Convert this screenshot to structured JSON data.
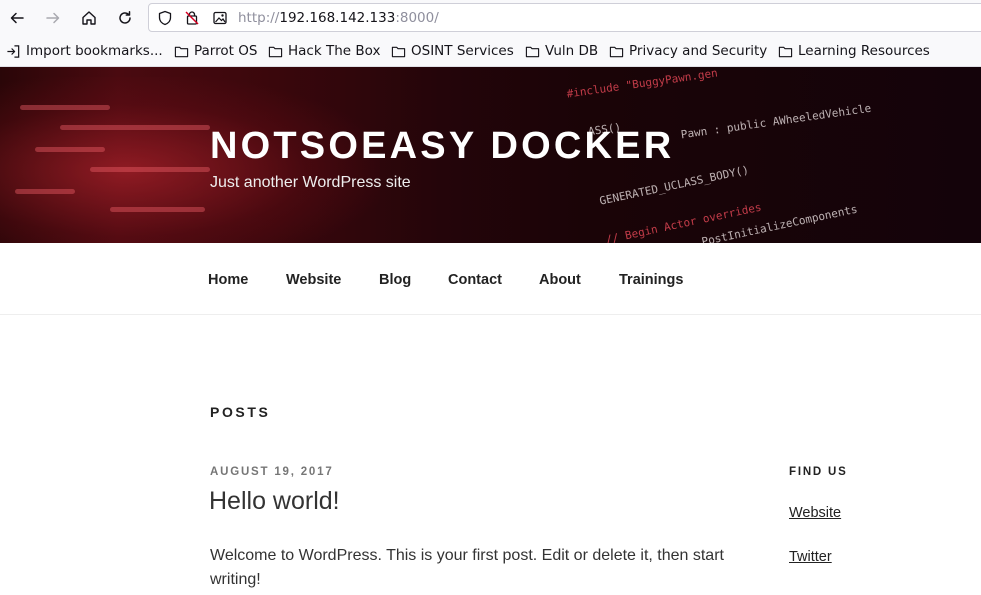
{
  "browser": {
    "url_protocol": "http://",
    "url_host": "192.168.142.133",
    "url_port": ":8000/",
    "icons": [
      "back-icon",
      "forward-icon",
      "home-icon",
      "reload-icon",
      "shield-icon",
      "no-tracking-icon",
      "image-permission-icon"
    ]
  },
  "bookmarks": [
    {
      "label": "Import bookmarks..."
    },
    {
      "label": "Parrot OS"
    },
    {
      "label": "Hack The Box"
    },
    {
      "label": "OSINT Services"
    },
    {
      "label": "Vuln DB"
    },
    {
      "label": "Privacy and Security"
    },
    {
      "label": "Learning Resources"
    }
  ],
  "site": {
    "title": "NOTSOEASY DOCKER",
    "description": "Just another WordPress site"
  },
  "hero_code": {
    "line1": "#include \"BuggyPawn.gen",
    "line2": "Pawn : public AWheeledVehicle",
    "line3": "GENERATED_UCLASS_BODY()",
    "line4": "// Begin Actor overrides",
    "line5": "PostInitializeComponents",
    "line6": "ASS()"
  },
  "nav": {
    "items": [
      "Home",
      "Website",
      "Blog",
      "Contact",
      "About",
      "Trainings"
    ]
  },
  "main": {
    "section_title": "POSTS",
    "post": {
      "date": "AUGUST 19, 2017",
      "title": "Hello world!",
      "excerpt": "Welcome to WordPress. This is your first post. Edit or delete it, then start writing!"
    }
  },
  "sidebar": {
    "widget_title": "FIND US",
    "links": [
      "Website",
      "Twitter"
    ]
  },
  "colors": {
    "hero_dark": "#1a0407",
    "hero_red": "#c82832",
    "text_dark": "#222222",
    "meta_gray": "#767676"
  }
}
